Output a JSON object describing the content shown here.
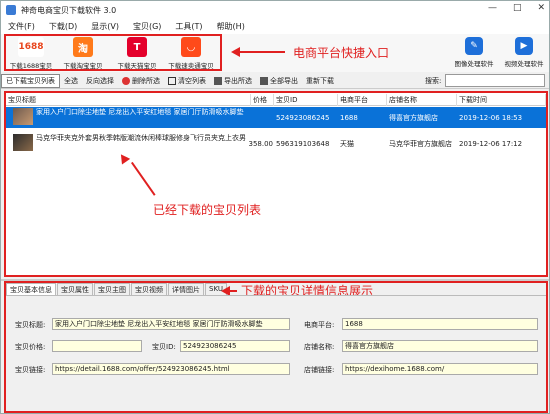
{
  "window": {
    "title": "神奇电商宝贝下载软件 3.0",
    "controls": [
      "—",
      "□",
      "✕"
    ]
  },
  "menu": [
    "文件(F)",
    "下载(D)",
    "显示(V)",
    "宝贝(G)",
    "工具(T)",
    "帮助(H)"
  ],
  "platforms": [
    {
      "logo": "1688",
      "label": "下载1688宝贝",
      "color": "#ffffff",
      "text_color": "#e8461e"
    },
    {
      "logo": "淘",
      "label": "下载淘宝宝贝",
      "color": "#ff7a1a",
      "text_color": "#ffffff"
    },
    {
      "logo": "T",
      "label": "下载天猫宝贝",
      "color": "#e4002b",
      "text_color": "#ffffff"
    },
    {
      "logo": "◡",
      "label": "下载速卖通宝贝",
      "color": "#ff4a1a",
      "text_color": "#ffffff"
    }
  ],
  "right_tools": [
    {
      "icon": "image-edit-icon",
      "glyph": "✎",
      "label": "图像处理软件"
    },
    {
      "icon": "video-camera-icon",
      "glyph": "▶",
      "label": "视频处理软件"
    }
  ],
  "annotations": {
    "platform": "电商平台快捷入口",
    "list": "已经下载的宝贝列表",
    "detail": "下载的宝贝详情信息展示"
  },
  "toolbar": {
    "items": [
      "已下载宝贝列表",
      "全选",
      "反向选择",
      "删除所选",
      "清空列表",
      "导出所选",
      "全部导出",
      "重新下载"
    ],
    "search_label": "搜索:",
    "search_value": ""
  },
  "table": {
    "columns": [
      "宝贝标题",
      "价格",
      "宝贝ID",
      "电商平台",
      "店铺名称",
      "下载时间"
    ],
    "rows": [
      {
        "title": "家用入户门口除尘地垫 尼龙出入平安红地毯 家居门厅防滑吸水脚垫",
        "price": "",
        "id": "524923086245",
        "platform": "1688",
        "shop": "得喜官方旗舰店",
        "time": "2019-12-06 18:53",
        "selected": true
      },
      {
        "title": "马克华菲夹克外套男秋季韩版潮流休闲棒球服修身飞行员夹克上衣男",
        "price": "358.00",
        "id": "596319103648",
        "platform": "天猫",
        "shop": "马克华菲官方旗舰店",
        "time": "2019-12-06 17:12",
        "selected": false
      }
    ]
  },
  "detail_tabs": [
    "宝贝基本信息",
    "宝贝属性",
    "宝贝主图",
    "宝贝视频",
    "详情图片",
    "SKU"
  ],
  "detail": {
    "title_label": "宝贝标题:",
    "title_value": "家用入户门口除尘地垫 尼龙出入平安红地毯 家居门厅防滑吸水脚垫",
    "platform_label": "电商平台:",
    "platform_value": "1688",
    "price_label": "宝贝价格:",
    "price_value": "",
    "id_label": "宝贝ID:",
    "id_value": "524923086245",
    "shop_label": "店铺名称:",
    "shop_value": "得喜官方旗舰店",
    "link_label": "宝贝链接:",
    "link_value": "https://detail.1688.com/offer/524923086245.html",
    "shoplink_label": "店铺链接:",
    "shoplink_value": "https://dexihome.1688.com/"
  },
  "colors": {
    "accent_red": "#e02020",
    "selection_blue": "#0a72d8",
    "field_yellow": "#ffffe0"
  }
}
